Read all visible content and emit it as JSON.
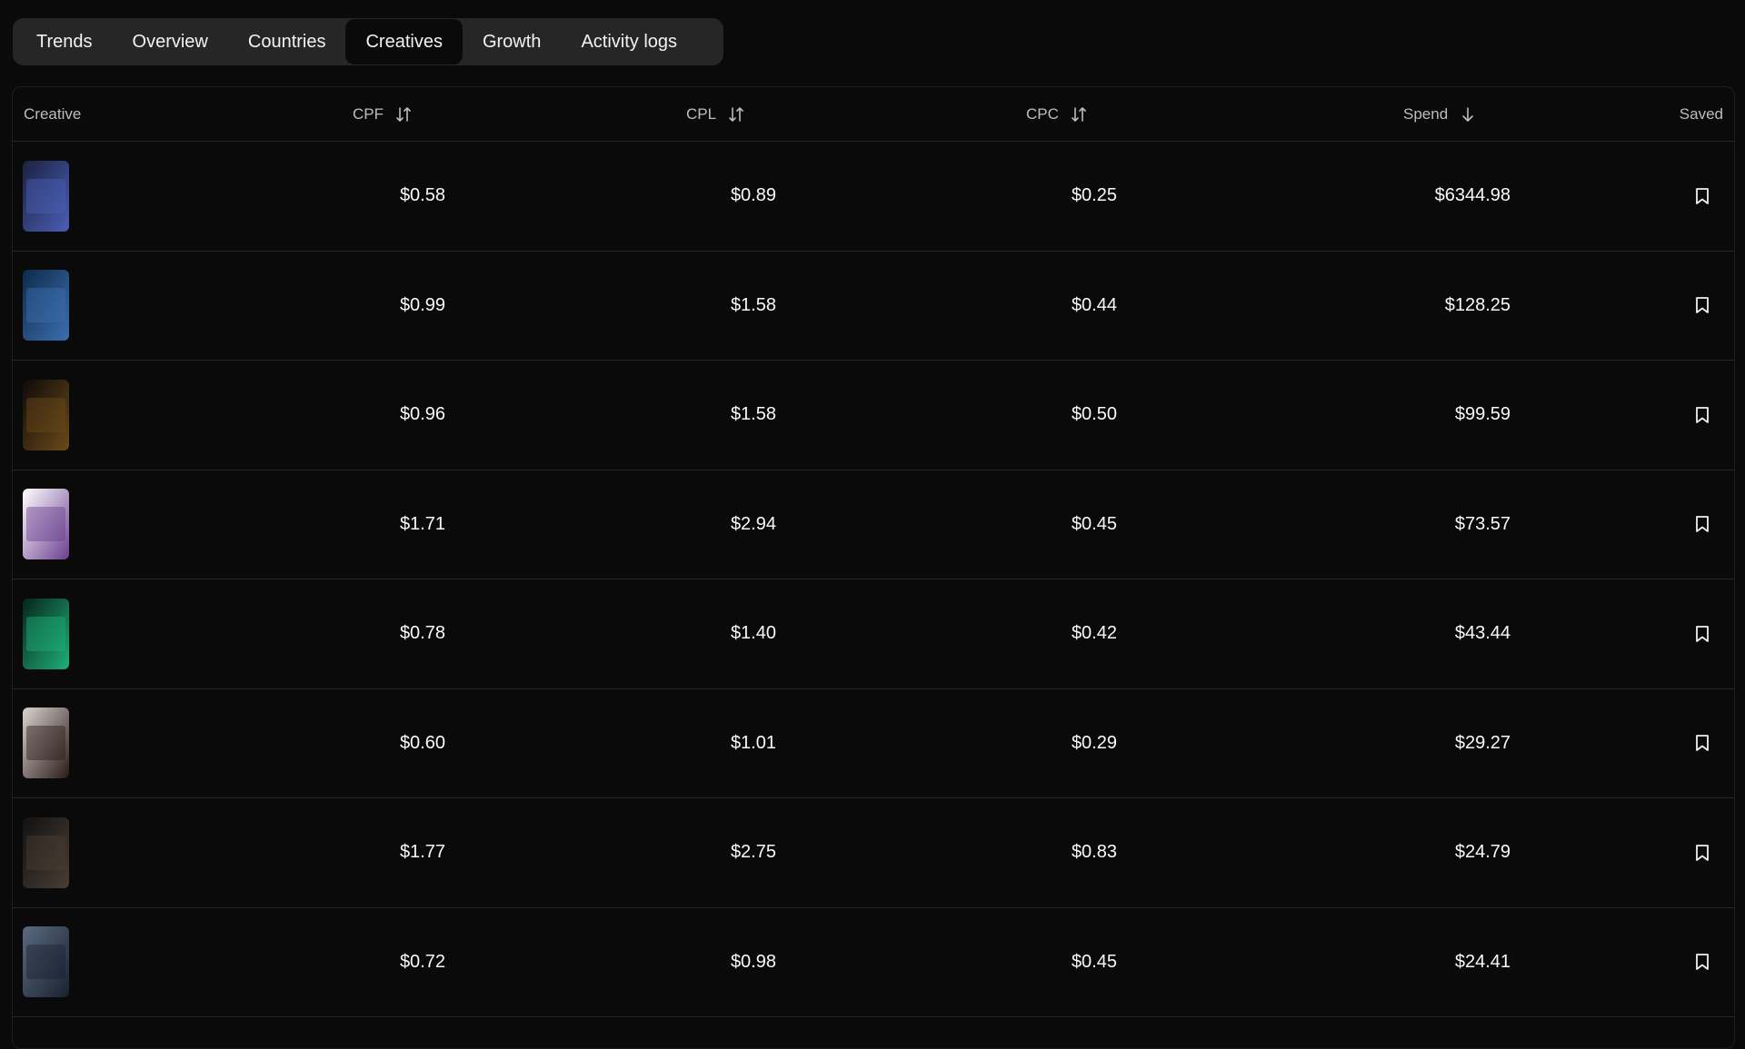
{
  "tabs": [
    {
      "label": "Trends"
    },
    {
      "label": "Overview"
    },
    {
      "label": "Countries"
    },
    {
      "label": "Creatives"
    },
    {
      "label": "Growth"
    },
    {
      "label": "Activity logs"
    }
  ],
  "active_tab": "Creatives",
  "table": {
    "columns": {
      "creative": "Creative",
      "cpf": "CPF",
      "cpl": "CPL",
      "cpc": "CPC",
      "spend": "Spend",
      "saved": "Saved"
    },
    "sort": {
      "column": "Spend",
      "direction": "descending"
    },
    "rows": [
      {
        "cpf": "$0.58",
        "cpl": "$0.89",
        "cpc": "$0.25",
        "spend": "$6344.98",
        "thumb_colors": [
          "#1b2140",
          "#4b5fb5"
        ]
      },
      {
        "cpf": "$0.99",
        "cpl": "$1.58",
        "cpc": "$0.44",
        "spend": "$128.25",
        "thumb_colors": [
          "#0f2a4a",
          "#3b6fb0"
        ]
      },
      {
        "cpf": "$0.96",
        "cpl": "$1.58",
        "cpc": "$0.50",
        "spend": "$99.59",
        "thumb_colors": [
          "#0d0b08",
          "#6b4a1a"
        ]
      },
      {
        "cpf": "$1.71",
        "cpl": "$2.94",
        "cpc": "$0.45",
        "spend": "$73.57",
        "thumb_colors": [
          "#ffffff",
          "#6a3f8f"
        ]
      },
      {
        "cpf": "$0.78",
        "cpl": "$1.40",
        "cpc": "$0.42",
        "spend": "$43.44",
        "thumb_colors": [
          "#06251b",
          "#1fb07a"
        ]
      },
      {
        "cpf": "$0.60",
        "cpl": "$1.01",
        "cpc": "$0.29",
        "spend": "$29.27",
        "thumb_colors": [
          "#d9d4d0",
          "#2a1a18"
        ]
      },
      {
        "cpf": "$1.77",
        "cpl": "$2.75",
        "cpc": "$0.83",
        "spend": "$24.79",
        "thumb_colors": [
          "#121212",
          "#4a3d34"
        ]
      },
      {
        "cpf": "$0.72",
        "cpl": "$0.98",
        "cpc": "$0.45",
        "spend": "$24.41",
        "thumb_colors": [
          "#5a6a80",
          "#1a2230"
        ]
      }
    ]
  },
  "icons": {
    "sort": "sort-arrows-icon",
    "sort_desc": "arrow-down-icon",
    "save": "bookmark-icon"
  }
}
